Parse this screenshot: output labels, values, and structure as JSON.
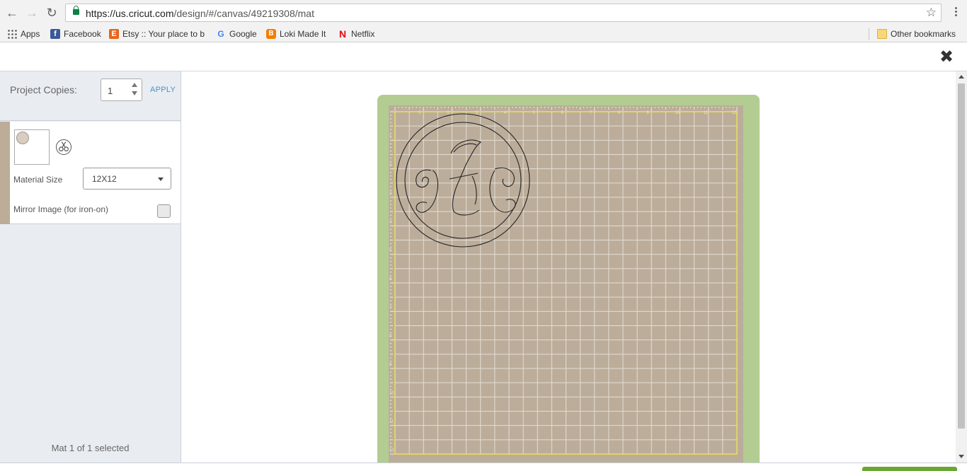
{
  "browser": {
    "url_host": "https://us.cricut.com",
    "url_path": "/design/#/canvas/49219308/mat",
    "bookmarks": [
      {
        "label": "Apps",
        "icon": "apps-grid-icon"
      },
      {
        "label": "Facebook",
        "icon": "facebook-icon"
      },
      {
        "label": "Etsy :: Your place to b",
        "icon": "etsy-icon"
      },
      {
        "label": "Google",
        "icon": "google-icon"
      },
      {
        "label": "Loki Made It",
        "icon": "blogger-icon"
      },
      {
        "label": "Netflix",
        "icon": "netflix-icon"
      }
    ],
    "other_bookmarks": "Other bookmarks"
  },
  "header": {
    "close_icon": "close-icon"
  },
  "sidebar": {
    "copies_label": "Project Copies:",
    "copies_value": "1",
    "apply_label": "APPLY",
    "mat": {
      "material_size_label": "Material Size",
      "material_size_value": "12X12",
      "mirror_label": "Mirror Image (for iron-on)",
      "mirror_checked": false
    },
    "mat_count": "Mat 1 of 1 selected"
  },
  "canvas": {
    "ruler_numbers": [
      "1",
      "2",
      "3",
      "4",
      "5",
      "6",
      "7",
      "8",
      "9",
      "10",
      "11",
      "12"
    ],
    "design_name": "monogram-circle"
  },
  "colors": {
    "mat_green": "#b3cc91",
    "mat_surface": "#bcad9b",
    "accent_blue": "#4a90c8",
    "go_green": "#6aa632"
  }
}
